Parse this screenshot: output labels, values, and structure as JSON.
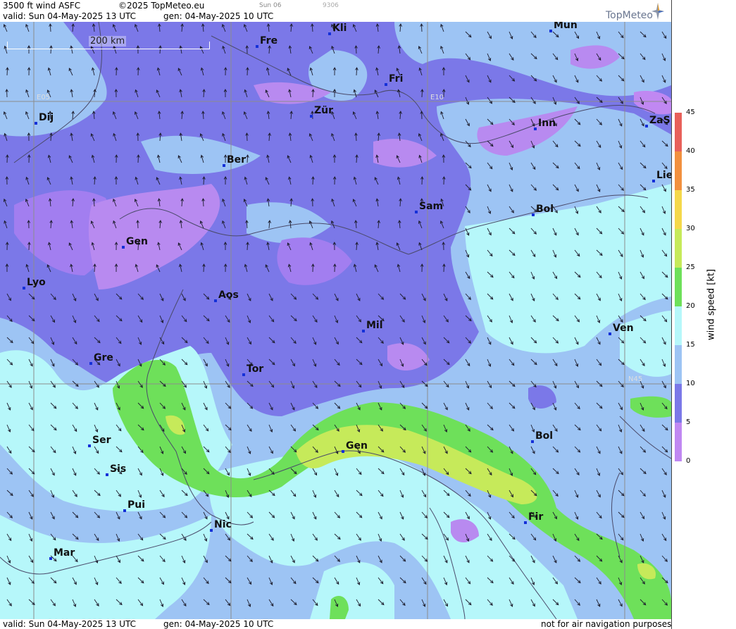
{
  "header": {
    "line1_title": "3500 ft wind ASFC",
    "line1_copyright": "©2025 TopMeteo.eu",
    "line1_day": "Sun 06",
    "line1_code": "9306",
    "line2_valid": "valid:  Sun  04-May-2025  13 UTC",
    "line2_gen": "gen: 04-May-2025 10 UTC",
    "logo": "TopMeteo"
  },
  "footer": {
    "valid": "valid:  Sun  04-May-2025  13 UTC",
    "gen": "gen: 04-May-2025 10 UTC",
    "disclaimer": "not for air navigation purposes"
  },
  "map": {
    "scale_label": "200 km",
    "grid_labels": {
      "e05": "E05",
      "e10": "E10",
      "n45": "N45"
    },
    "cities": [
      {
        "name": "Kli"
      },
      {
        "name": "Mün"
      },
      {
        "name": "Fre"
      },
      {
        "name": "Fri"
      },
      {
        "name": "Dij"
      },
      {
        "name": "Zür"
      },
      {
        "name": "Inn"
      },
      {
        "name": "ZaS"
      },
      {
        "name": "Ber"
      },
      {
        "name": "Lie"
      },
      {
        "name": "Sam"
      },
      {
        "name": "Bol"
      },
      {
        "name": "Gen"
      },
      {
        "name": "Lyo"
      },
      {
        "name": "Aos"
      },
      {
        "name": "Mil"
      },
      {
        "name": "Ven"
      },
      {
        "name": "Gre"
      },
      {
        "name": "Tor"
      },
      {
        "name": "Ser"
      },
      {
        "name": "Bol"
      },
      {
        "name": "Gen"
      },
      {
        "name": "Sis"
      },
      {
        "name": "Pui"
      },
      {
        "name": "Fir"
      },
      {
        "name": "Nic"
      },
      {
        "name": "Mar"
      }
    ]
  },
  "legend": {
    "title": "wind speed [kt]",
    "ticks": [
      "45",
      "40",
      "35",
      "30",
      "25",
      "20",
      "15",
      "10",
      "5",
      "0"
    ],
    "colors": [
      "#e8605a",
      "#f2903e",
      "#f5d84a",
      "#c6ea5a",
      "#6ee05a",
      "#b6f7fa",
      "#9dc4f4",
      "#7b78e8",
      "#c088f2"
    ]
  }
}
